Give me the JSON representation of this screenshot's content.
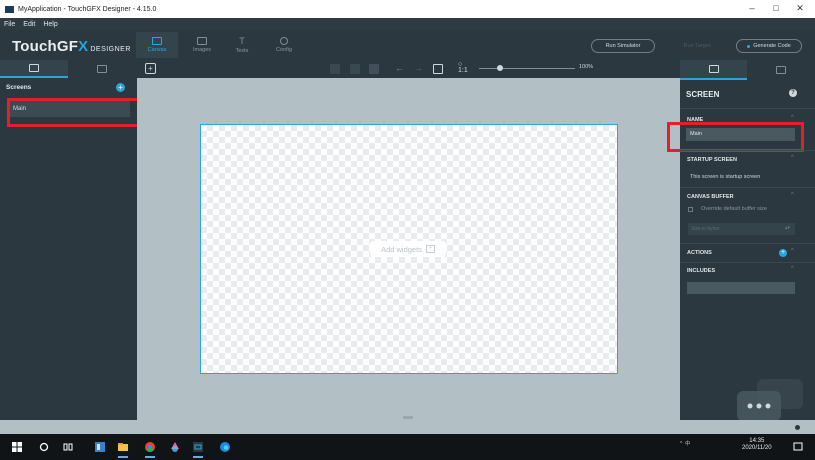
{
  "window": {
    "title": "MyApplication - TouchGFX Designer - 4.15.0",
    "controls": [
      "–",
      "□",
      "✕"
    ]
  },
  "menu": [
    "File",
    "Edit",
    "Help"
  ],
  "logo": {
    "main": "TouchGF",
    "accent": "X",
    "suffix": "DESIGNER"
  },
  "nav_tabs": [
    {
      "label": "Canvas",
      "icon": "canvas-icon",
      "active": true
    },
    {
      "label": "Images",
      "icon": "images-icon",
      "active": false
    },
    {
      "label": "Texts",
      "icon": "texts-icon",
      "active": false
    },
    {
      "label": "Config",
      "icon": "config-icon",
      "active": false
    }
  ],
  "actions": {
    "run_simulator": "Run Simulator",
    "run_target": "Run Target",
    "generate_code": "Generate Code"
  },
  "left_panel": {
    "header": "Screens",
    "screens": [
      "Main"
    ]
  },
  "toolbar": {
    "zoom": "100%"
  },
  "canvas": {
    "placeholder": "Add widgets"
  },
  "properties": {
    "title": "SCREEN",
    "name_label": "NAME",
    "name_value": "Main",
    "startup_label": "STARTUP SCREEN",
    "startup_text": "This screen is startup screen",
    "canvas_buffer_label": "CANVAS BUFFER",
    "override_label": "Override default buffer size",
    "buffer_placeholder": "Size in bytes",
    "actions_label": "ACTIONS",
    "includes_label": "INCLUDES"
  },
  "taskbar": {
    "tray": "^ ️ 中",
    "time": "14:35",
    "date": "2020/11/20"
  },
  "colors": {
    "accent": "#2aa6dd",
    "panel": "#2b3840",
    "highlight": "#e0202a",
    "canvas_bg": "#b2bfc5"
  }
}
